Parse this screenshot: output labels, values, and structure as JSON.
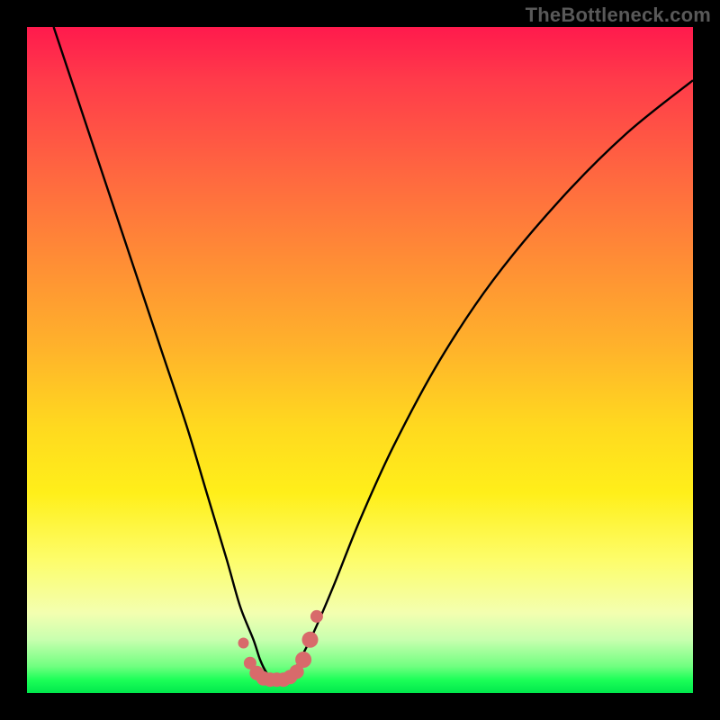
{
  "watermark": "TheBottleneck.com",
  "colors": {
    "black": "#000000",
    "curve": "#000000",
    "marker": "#d86a6b"
  },
  "chart_data": {
    "type": "line",
    "title": "",
    "xlabel": "",
    "ylabel": "",
    "xlim": [
      0,
      100
    ],
    "ylim": [
      0,
      100
    ],
    "grid": false,
    "series": [
      {
        "name": "bottleneck_curve",
        "x": [
          4,
          8,
          12,
          16,
          20,
          24,
          27,
          30,
          32,
          34,
          35,
          36,
          37,
          38,
          39,
          40,
          41,
          43,
          46,
          50,
          55,
          62,
          70,
          80,
          90,
          100
        ],
        "y": [
          100,
          88,
          76,
          64,
          52,
          40,
          30,
          20,
          13,
          8,
          5,
          3,
          2,
          2,
          2,
          3,
          5,
          9,
          16,
          26,
          37,
          50,
          62,
          74,
          84,
          92
        ]
      }
    ],
    "markers": {
      "name": "bottom_dots",
      "x": [
        32.5,
        33.5,
        34.5,
        35.5,
        36.5,
        37.5,
        38.5,
        39.5,
        40.5,
        41.5,
        42.5,
        43.5
      ],
      "y": [
        7.5,
        4.5,
        3.0,
        2.2,
        2.0,
        2.0,
        2.0,
        2.4,
        3.2,
        5.0,
        8.0,
        11.5
      ],
      "radius": [
        6,
        7,
        8,
        8,
        8,
        8,
        8,
        8,
        8,
        9,
        9,
        7
      ]
    }
  }
}
